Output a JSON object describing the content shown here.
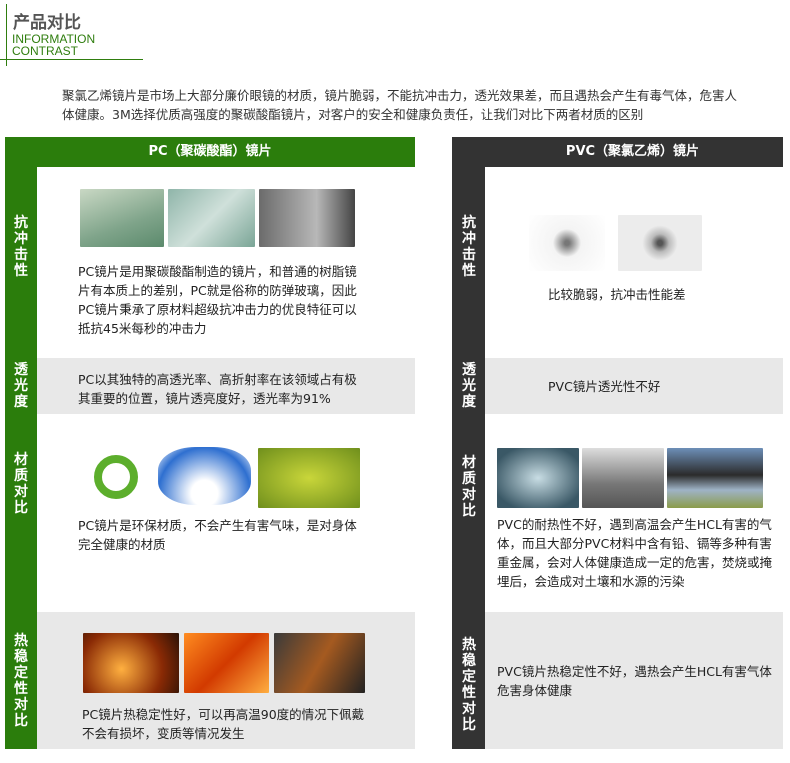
{
  "header": {
    "title": "产品对比",
    "subtitle_line1": "INFORMATION",
    "subtitle_line2": "CONTRAST"
  },
  "intro": "聚氯乙烯镜片是市场上大部分廉价眼镜的材质，镜片脆弱，不能抗冲击力，透光效果差，而且遇热会产生有毒气体，危害人体健康。3M选择优质高强度的聚碳酸酯镜片，对客户的安全和健康负责任，让我们对比下两者材质的区别",
  "colors": {
    "pc_green": "#2b7d0c",
    "pvc_dark": "#333333",
    "row_gray": "#e8e8e8"
  },
  "pc": {
    "heading": "PC（聚碳酸酯）镜片",
    "rows": [
      {
        "label": "抗冲击性",
        "text": "PC镜片是用聚碳酸酯制造的镜片，和普通的树脂镜片有本质上的差别，PC就是俗称的防弹玻璃，因此PC镜片秉承了原材料超级抗冲击力的优良特征可以抵抗45米每秒的冲击力"
      },
      {
        "label": "透光度",
        "text": "PC以其独特的高透光率、高折射率在该领域占有极其重要的位置，镜片透亮度好，透光率为91%"
      },
      {
        "label": "材质对比",
        "text": "PC镜片是环保材质，不会产生有害气味，是对身体完全健康的材质"
      },
      {
        "label": "热稳定性对比",
        "text": "PC镜片热稳定性好，可以再高温90度的情况下佩戴不会有损坏，变质等情况发生"
      }
    ]
  },
  "pvc": {
    "heading": "PVC（聚氯乙烯）镜片",
    "rows": [
      {
        "label": "抗冲击性",
        "text": "比较脆弱，抗冲击性能差"
      },
      {
        "label": "透光度",
        "text": "PVC镜片透光性不好"
      },
      {
        "label": "材质对比",
        "text": "PVC的耐热性不好，遇到高温会产生HCL有害的气体，而且大部分PVC材料中含有铅、镉等多种有害重金属，会对人体健康造成一定的危害，焚烧或掩埋后，会造成对土壤和水源的污染"
      },
      {
        "label": "热稳定性对比",
        "text": "PVC镜片热稳定性不好，遇热会产生HCL有害气体危害身体健康"
      }
    ]
  }
}
